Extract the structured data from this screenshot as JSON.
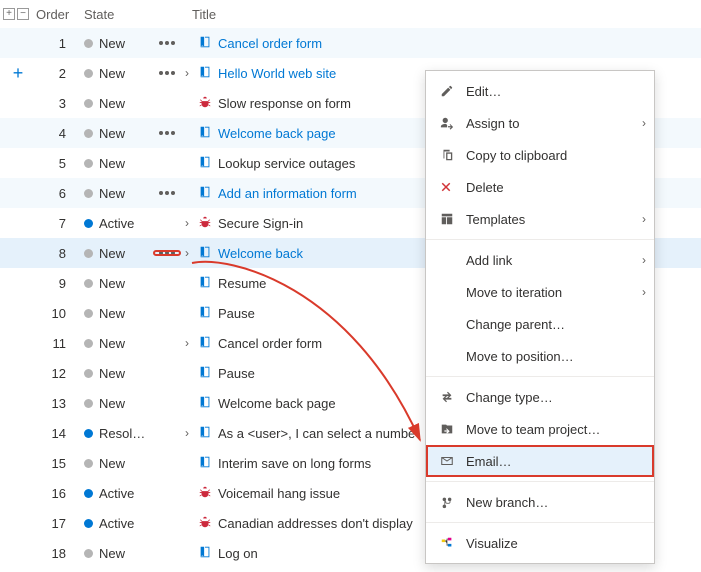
{
  "headers": {
    "order": "Order",
    "state": "State",
    "title": "Title"
  },
  "stateLabels": {
    "new": "New",
    "active": "Active",
    "resolving": "Resol…"
  },
  "addIcon": "+",
  "rows": [
    {
      "order": "1",
      "state": "New",
      "dot": "grey",
      "more": true,
      "expand": false,
      "icon": "book",
      "title": "Cancel order form",
      "alt": true,
      "link": true,
      "addSlot": false
    },
    {
      "order": "2",
      "state": "New",
      "dot": "grey",
      "more": true,
      "expand": true,
      "icon": "book",
      "title": "Hello World web site",
      "alt": false,
      "link": true,
      "addSlot": true
    },
    {
      "order": "3",
      "state": "New",
      "dot": "grey",
      "more": false,
      "expand": false,
      "icon": "bug",
      "title": "Slow response on form",
      "alt": false,
      "link": false,
      "addSlot": false
    },
    {
      "order": "4",
      "state": "New",
      "dot": "grey",
      "more": true,
      "expand": false,
      "icon": "book",
      "title": "Welcome back page",
      "alt": true,
      "link": true,
      "addSlot": false
    },
    {
      "order": "5",
      "state": "New",
      "dot": "grey",
      "more": false,
      "expand": false,
      "icon": "book",
      "title": "Lookup service outages",
      "alt": false,
      "link": false,
      "addSlot": false
    },
    {
      "order": "6",
      "state": "New",
      "dot": "grey",
      "more": true,
      "expand": false,
      "icon": "book",
      "title": "Add an information form",
      "alt": true,
      "link": true,
      "addSlot": false,
      "tick": true
    },
    {
      "order": "7",
      "state": "Active",
      "dot": "blue",
      "more": false,
      "expand": true,
      "icon": "bug",
      "title": "Secure Sign-in",
      "alt": false,
      "link": false,
      "addSlot": false
    },
    {
      "order": "8",
      "state": "New",
      "dot": "grey",
      "more": true,
      "expand": true,
      "icon": "book",
      "title": "Welcome back",
      "alt": false,
      "link": true,
      "addSlot": false,
      "hl": true,
      "boxMore": true
    },
    {
      "order": "9",
      "state": "New",
      "dot": "grey",
      "more": false,
      "expand": false,
      "icon": "book",
      "title": "Resume",
      "alt": false,
      "link": false,
      "addSlot": false
    },
    {
      "order": "10",
      "state": "New",
      "dot": "grey",
      "more": false,
      "expand": false,
      "icon": "book",
      "title": "Pause",
      "alt": false,
      "link": false,
      "addSlot": false
    },
    {
      "order": "11",
      "state": "New",
      "dot": "grey",
      "more": false,
      "expand": true,
      "icon": "book",
      "title": "Cancel order form",
      "alt": false,
      "link": false,
      "addSlot": false
    },
    {
      "order": "12",
      "state": "New",
      "dot": "grey",
      "more": false,
      "expand": false,
      "icon": "book",
      "title": "Pause",
      "alt": false,
      "link": false,
      "addSlot": false
    },
    {
      "order": "13",
      "state": "New",
      "dot": "grey",
      "more": false,
      "expand": false,
      "icon": "book",
      "title": "Welcome back page",
      "alt": false,
      "link": false,
      "addSlot": false
    },
    {
      "order": "14",
      "state": "Resol…",
      "dot": "blue",
      "more": false,
      "expand": true,
      "icon": "book",
      "title": "As a  <user>, I can select a numbe",
      "alt": false,
      "link": false,
      "addSlot": false
    },
    {
      "order": "15",
      "state": "New",
      "dot": "grey",
      "more": false,
      "expand": false,
      "icon": "book",
      "title": "Interim save on long forms",
      "alt": false,
      "link": false,
      "addSlot": false
    },
    {
      "order": "16",
      "state": "Active",
      "dot": "blue",
      "more": false,
      "expand": false,
      "icon": "bug",
      "title": "Voicemail hang issue",
      "alt": false,
      "link": false,
      "addSlot": false
    },
    {
      "order": "17",
      "state": "Active",
      "dot": "blue",
      "more": false,
      "expand": false,
      "icon": "bug",
      "title": "Canadian addresses don't display",
      "alt": false,
      "link": false,
      "addSlot": false
    },
    {
      "order": "18",
      "state": "New",
      "dot": "grey",
      "more": false,
      "expand": false,
      "icon": "book",
      "title": "Log on",
      "alt": false,
      "link": false,
      "addSlot": false
    }
  ],
  "menu": {
    "edit": "Edit…",
    "assignTo": "Assign to",
    "copy": "Copy to clipboard",
    "delete": "Delete",
    "templates": "Templates",
    "addLink": "Add link",
    "moveIter": "Move to iteration",
    "changeParent": "Change parent…",
    "movePos": "Move to position…",
    "changeType": "Change type…",
    "moveTeam": "Move to team project…",
    "email": "Email…",
    "newBranch": "New branch…",
    "visualize": "Visualize"
  }
}
